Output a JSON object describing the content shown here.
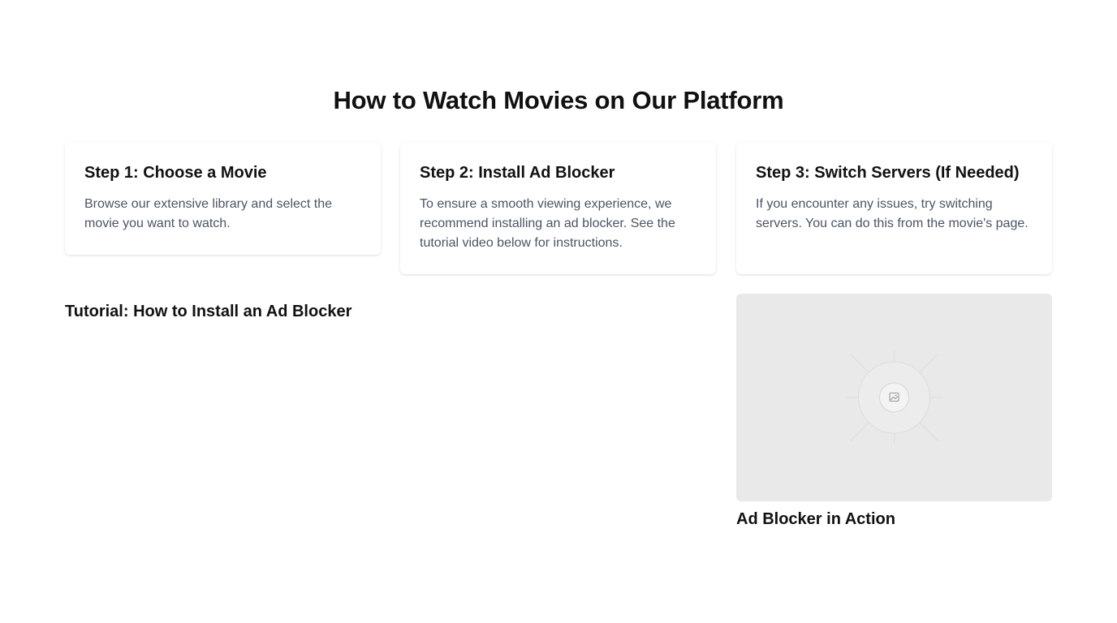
{
  "page": {
    "title": "How to Watch Movies on Our Platform"
  },
  "steps": [
    {
      "title": "Step 1: Choose a Movie",
      "description": "Browse our extensive library and select the movie you want to watch."
    },
    {
      "title": "Step 2: Install Ad Blocker",
      "description": "To ensure a smooth viewing experience, we recommend installing an ad blocker. See the tutorial video below for instructions."
    },
    {
      "title": "Step 3: Switch Servers (If Needed)",
      "description": "If you encounter any issues, try switching servers. You can do this from the movie's page."
    }
  ],
  "tutorial": {
    "title": "Tutorial: How to Install an Ad Blocker"
  },
  "media": {
    "icon": "image-placeholder-icon",
    "caption": "Ad Blocker in Action"
  }
}
